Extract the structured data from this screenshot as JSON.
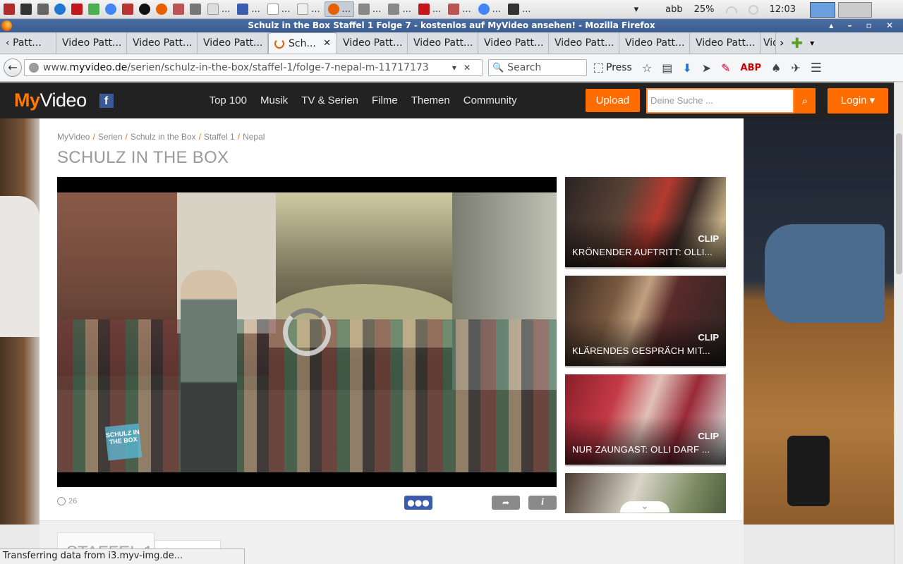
{
  "os_panel": {
    "tasks": [
      {
        "label": "...",
        "active": false
      },
      {
        "label": "...",
        "active": false
      },
      {
        "label": "...",
        "active": false
      },
      {
        "label": "...",
        "active": false
      },
      {
        "label": "...",
        "active": true
      },
      {
        "label": "...",
        "active": false
      },
      {
        "label": "...",
        "active": false
      },
      {
        "label": "...",
        "active": false
      },
      {
        "label": "...",
        "active": false
      },
      {
        "label": "...",
        "active": false
      },
      {
        "label": "...",
        "active": false
      }
    ],
    "tray_dropdown": "▾",
    "keyboard": "abb",
    "battery": "25%",
    "clock": "12:03"
  },
  "window": {
    "title": "Schulz in the Box Staffel 1 Folge 7 - kostenlos auf MyVideo ansehen! - Mozilla Firefox",
    "controls": "▴ – ▫ ✕"
  },
  "tabs": [
    {
      "label": "Patt..."
    },
    {
      "label": "Video Patt..."
    },
    {
      "label": "Video Patt..."
    },
    {
      "label": "Video Patt..."
    },
    {
      "label": "Sch..."
    },
    {
      "label": "Video Patt..."
    },
    {
      "label": "Video Patt..."
    },
    {
      "label": "Video Patt..."
    },
    {
      "label": "Video Patt..."
    },
    {
      "label": "Video Patt..."
    },
    {
      "label": "Video Patt..."
    },
    {
      "label": "Video Patt..."
    }
  ],
  "navbar": {
    "url_prefix": "www.",
    "url_domain": "myvideo.de",
    "url_path": "/serien/schulz-in-the-box/staffel-1/folge-7-nepal-m-11717173",
    "search_placeholder": "Search",
    "press_label": "Press"
  },
  "site": {
    "logo_my": "My",
    "logo_video": "Video",
    "facebook": "f",
    "nav": [
      "Top 100",
      "Musik",
      "TV & Serien",
      "Filme",
      "Themen",
      "Community"
    ],
    "upload": "Upload",
    "search_placeholder": "Deine Suche ...",
    "login": "Login ▾"
  },
  "breadcrumb": [
    "MyVideo",
    "Serien",
    "Schulz in the Box",
    "Staffel 1",
    "Nepal"
  ],
  "page_title": "SCHULZ IN THE BOX",
  "player": {
    "watermark": "SCHULZ IN THE BOX",
    "views": "26"
  },
  "clips": [
    {
      "tag": "CLIP",
      "title": "KRÖNENDER AUFTRITT: OLLI..."
    },
    {
      "tag": "CLIP",
      "title": "KLÄRENDES GESPRÄCH MIT..."
    },
    {
      "tag": "CLIP",
      "title": "NUR ZAUNGAST: OLLI DARF ..."
    }
  ],
  "season_tab": "STAFFEL 1",
  "status": "Transferring data from i3.myv-img.de..."
}
